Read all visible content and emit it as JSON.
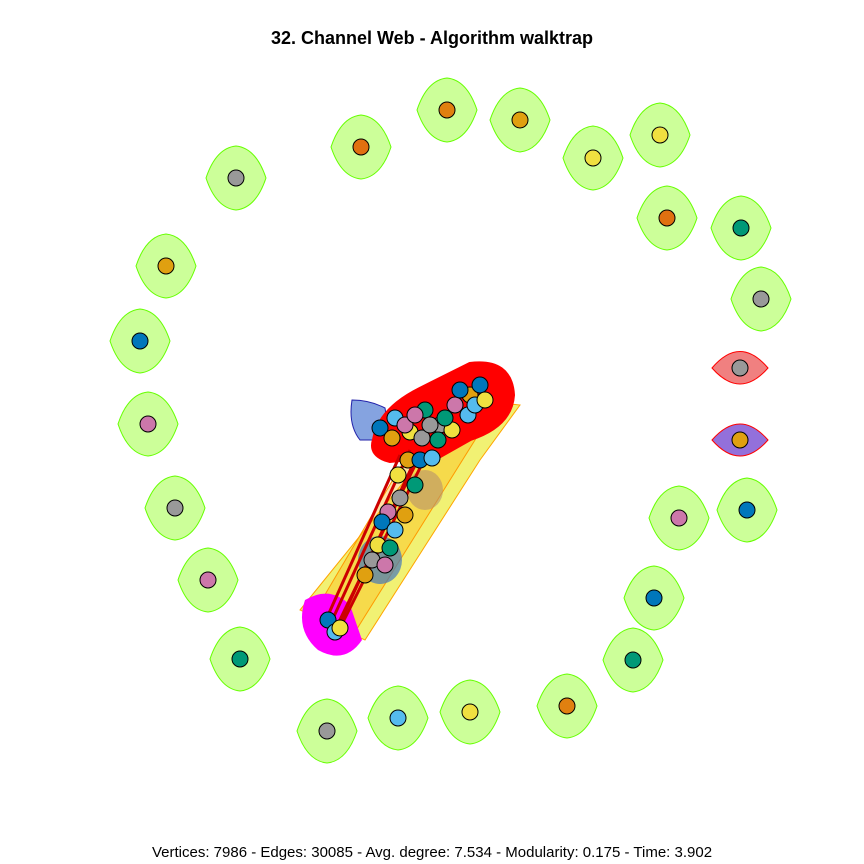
{
  "title": "32. Channel Web - Algorithm walktrap",
  "footer": "Vertices: 7986 - Edges: 30085 - Avg. degree: 7.534 - Modularity: 0.175 - Time: 3.902",
  "colors": {
    "community_fill": "#ccff99",
    "community_stroke": "#66ff00",
    "main_cluster": "#ff0000",
    "magenta_cluster": "#ff00ff",
    "pink_cluster": "#f08080",
    "purple_cluster": "#9370db"
  },
  "isolated_nodes": [
    {
      "color": "#e07010"
    },
    {
      "color": "#e08010"
    },
    {
      "color": "#e0a010"
    },
    {
      "color": "#f0e040"
    },
    {
      "color": "#f0e040"
    },
    {
      "color": "#e07010"
    },
    {
      "color": "#009977"
    },
    {
      "color": "#999999"
    },
    {
      "color": "#999999"
    },
    {
      "color": "#e0a010"
    },
    {
      "color": "#0077bb"
    },
    {
      "color": "#cc77aa"
    },
    {
      "color": "#999999"
    },
    {
      "color": "#cc77aa"
    },
    {
      "color": "#009977"
    },
    {
      "color": "#999999"
    },
    {
      "color": "#55bbee"
    },
    {
      "color": "#f0e040"
    },
    {
      "color": "#e08010"
    },
    {
      "color": "#009977"
    },
    {
      "color": "#0077bb"
    },
    {
      "color": "#cc77aa"
    },
    {
      "color": "#0077bb"
    },
    {
      "color": "#55bbee"
    },
    {
      "color": "#e0a010"
    }
  ]
}
